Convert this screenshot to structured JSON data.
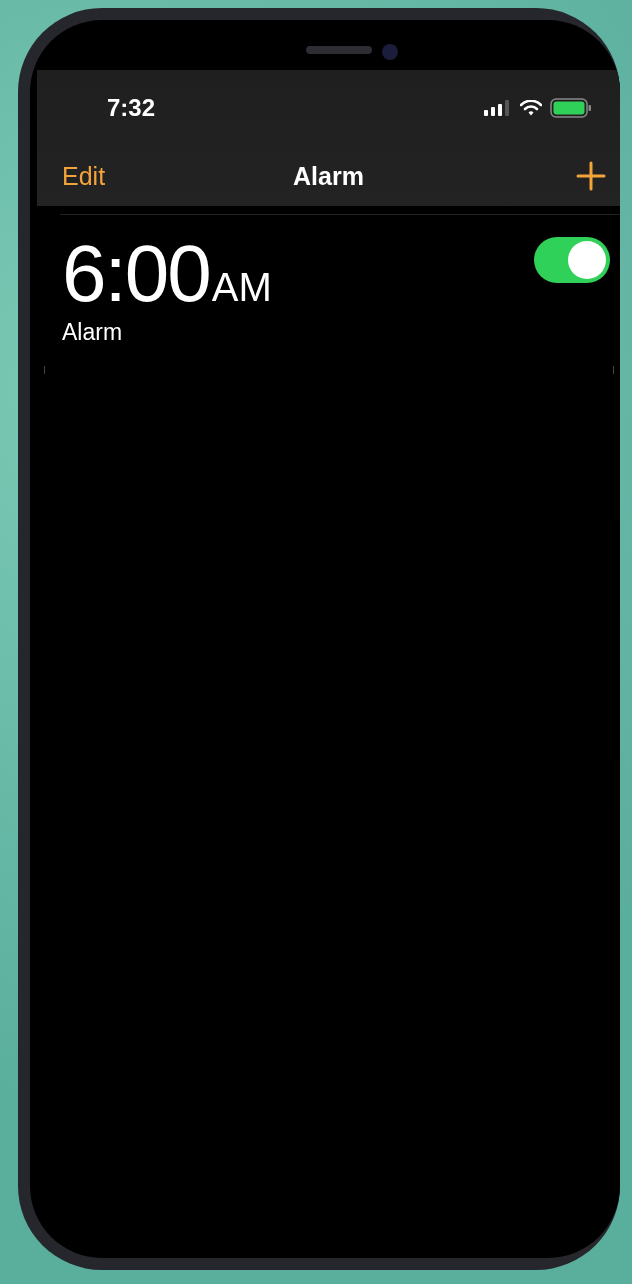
{
  "status_bar": {
    "time": "7:32"
  },
  "nav": {
    "edit": "Edit",
    "title": "Alarm"
  },
  "alarms": [
    {
      "time": "6:00",
      "period": "AM",
      "label": "Alarm",
      "on": true
    }
  ]
}
